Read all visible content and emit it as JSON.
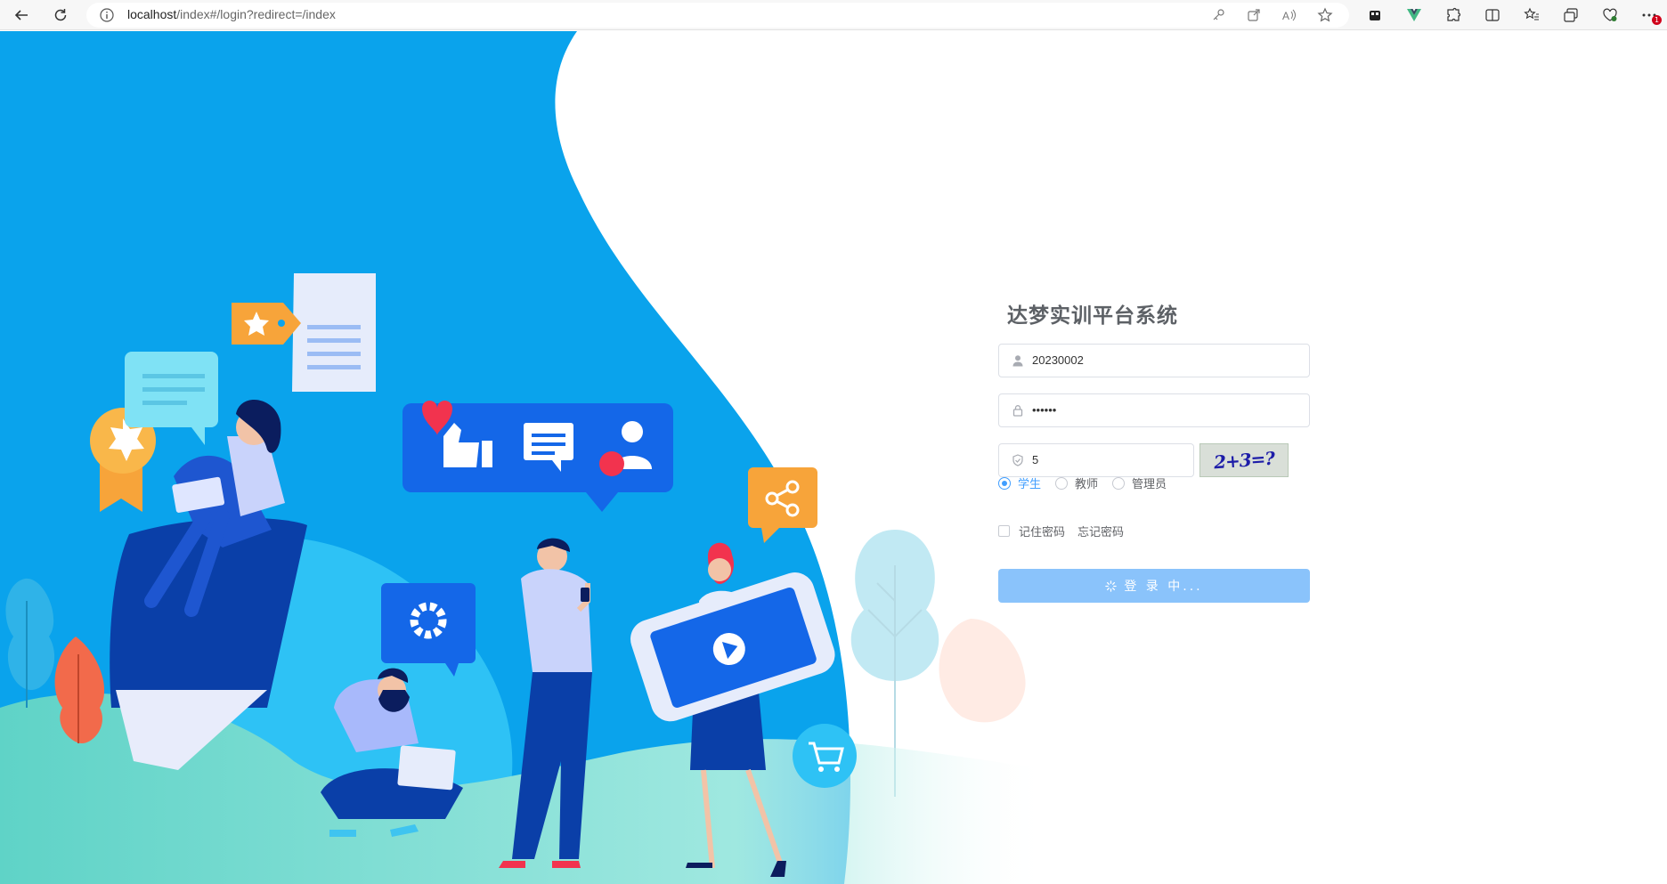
{
  "browser": {
    "url_host": "localhost",
    "url_rest": "/index#/login?redirect=/index",
    "notification_badge": "1"
  },
  "login": {
    "title": "达梦实训平台系统",
    "username_value": "20230002",
    "password_value": "••••••",
    "captcha_value": "5",
    "captcha_image_text": "2+3=?",
    "roles": [
      {
        "label": "学生",
        "checked": true
      },
      {
        "label": "教师",
        "checked": false
      },
      {
        "label": "管理员",
        "checked": false
      }
    ],
    "remember_label": "记住密码",
    "forgot_label": "忘记密码",
    "button_label": "登 录 中..."
  },
  "colors": {
    "primary": "#409eff",
    "button_loading": "#8ac3fb",
    "hero_blue": "#0aa3ec"
  }
}
